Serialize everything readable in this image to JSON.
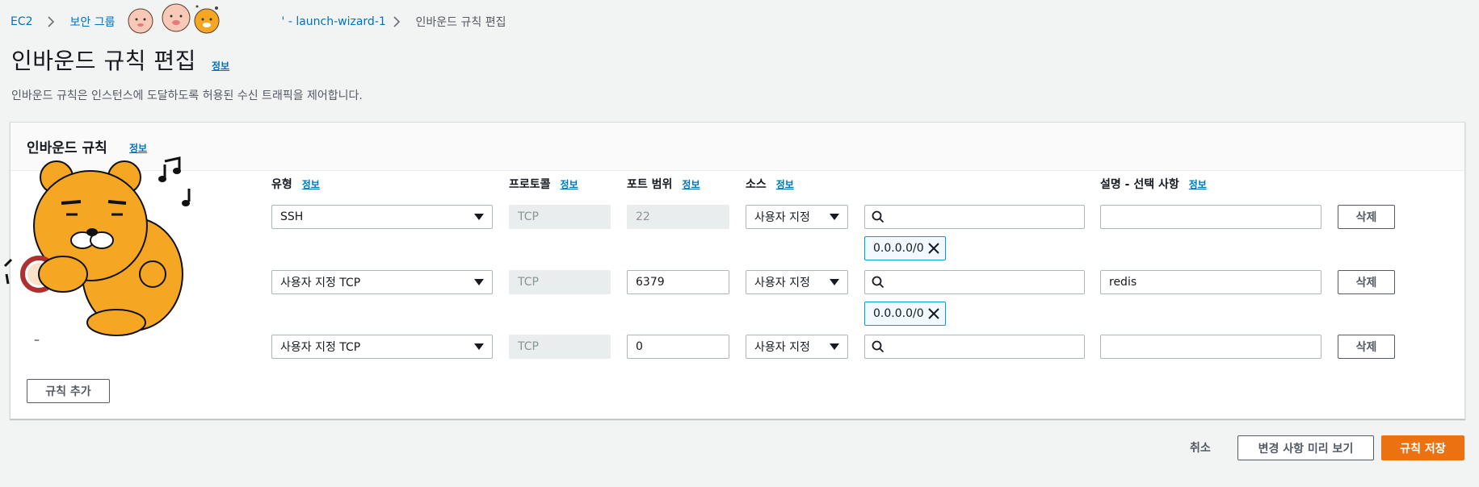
{
  "breadcrumb": {
    "ec2": "EC2",
    "security_groups": "보안 그룹",
    "group": "sg-0cb...565' ' - launch-wizard-1",
    "group_visible": "' - launch-wizard-1",
    "current": "인바운드 규칙 편집"
  },
  "page": {
    "title": "인바운드 규칙 편집",
    "info": "정보",
    "description": "인바운드 규칙은 인스턴스에 도달하도록 허용된 수신 트래픽을 제어합니다."
  },
  "panel": {
    "title": "인바운드 규칙",
    "info": "정보",
    "columns": {
      "type": "유형",
      "protocol": "프로토콜",
      "port_range": "포트 범위",
      "source": "소스",
      "description": "설명 - 선택 사항",
      "info": "정보"
    },
    "rows": [
      {
        "type": "SSH",
        "protocol": "TCP",
        "port": "22",
        "source_mode": "사용자 지정",
        "source_search": "",
        "cidr": "0.0.0.0/0",
        "description": "",
        "delete": "삭제",
        "rule_id": ""
      },
      {
        "type": "사용자 지정 TCP",
        "protocol": "TCP",
        "port": "6379",
        "source_mode": "사용자 지정",
        "source_search": "",
        "cidr": "0.0.0.0/0",
        "description": "redis",
        "delete": "삭제",
        "rule_id": ""
      },
      {
        "type": "사용자 지정 TCP",
        "protocol": "TCP",
        "port": "0",
        "source_mode": "사용자 지정",
        "source_search": "",
        "cidr": "",
        "description": "",
        "delete": "삭제",
        "rule_id": "–"
      }
    ],
    "add_rule": "규칙 추가"
  },
  "footer": {
    "cancel": "취소",
    "preview": "변경 사항 미리 보기",
    "save": "규칙 저장"
  },
  "colors": {
    "link": "#0073bb",
    "primary": "#ec7211",
    "token_border": "#00a1c9",
    "sticker_body": "#f5a623"
  },
  "icons": [
    "chevron-right-icon",
    "caret-down-icon",
    "search-icon",
    "close-icon",
    "ryan-sticker",
    "apeach-sticker",
    "music-note-icon"
  ]
}
